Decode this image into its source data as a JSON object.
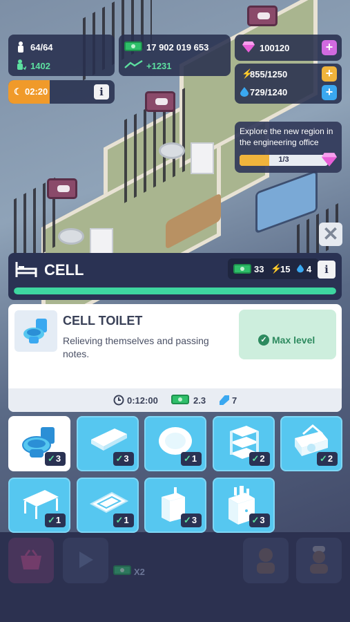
{
  "hud": {
    "prisoners": "64/64",
    "guards": "1402",
    "night_timer": "02:20",
    "cash": "17 902 019 653",
    "income": "+1231",
    "gems": "100120",
    "energy": "855/1250",
    "water": "729/1240"
  },
  "quest": {
    "text": "Explore the new region in the engineering office",
    "progress_label": "1/3",
    "progress_fraction": 0.333
  },
  "room": {
    "title": "CELL",
    "cash_stat": "33",
    "energy_stat": "15",
    "water_stat": "4",
    "progress_fraction": 1.0
  },
  "item": {
    "title": "CELL TOILET",
    "description": "Relieving themselves and passing notes.",
    "status": "Max level",
    "time": "0:12:00",
    "cash_rate": "2.3",
    "boost": "7"
  },
  "grid": [
    {
      "icon": "toilet-icon",
      "level": "3",
      "selected": true
    },
    {
      "icon": "bench-icon",
      "level": "3",
      "selected": false
    },
    {
      "icon": "plate-icon",
      "level": "1",
      "selected": false
    },
    {
      "icon": "shelf-icon",
      "level": "2",
      "selected": false
    },
    {
      "icon": "radio-icon",
      "level": "2",
      "selected": false
    },
    {
      "icon": "table-icon",
      "level": "1",
      "selected": false
    },
    {
      "icon": "rug-icon",
      "level": "1",
      "selected": false
    },
    {
      "icon": "sink-icon",
      "level": "3",
      "selected": false
    },
    {
      "icon": "cabinet-icon",
      "level": "3",
      "selected": false
    }
  ],
  "bottom": {
    "multiplier": "X2"
  },
  "colors": {
    "accent_green": "#3ed6a0",
    "tile_blue": "#56c7f0",
    "panel": "#2a3253"
  }
}
